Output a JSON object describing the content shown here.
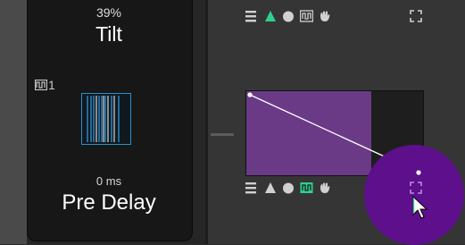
{
  "tilt": {
    "value": "39%",
    "label": "Tilt"
  },
  "pre_delay": {
    "value": "0 ms",
    "label": "Pre Delay"
  },
  "waveform": {
    "number": "1"
  },
  "envelope": {
    "shape": "descending-line",
    "start_level": 1.0,
    "end_level": 0.0,
    "shaded_fraction": 0.7
  },
  "colors": {
    "accent_green": "#2ed08e",
    "envelope_fill": "#6a3a87",
    "highlight_purple": "#5e0f8c",
    "bar_border": "#2d8fc9"
  },
  "top_toolbar": {
    "icons": [
      "lines-icon",
      "triangle-icon",
      "circle-icon",
      "square-wave-icon",
      "hand-icon",
      "expand-icon"
    ],
    "active": "triangle-icon"
  },
  "bottom_toolbar": {
    "icons": [
      "lines-icon",
      "triangle-icon",
      "circle-icon",
      "square-wave-icon",
      "hand-icon",
      "expand-icon"
    ],
    "active": "square-wave-icon"
  }
}
